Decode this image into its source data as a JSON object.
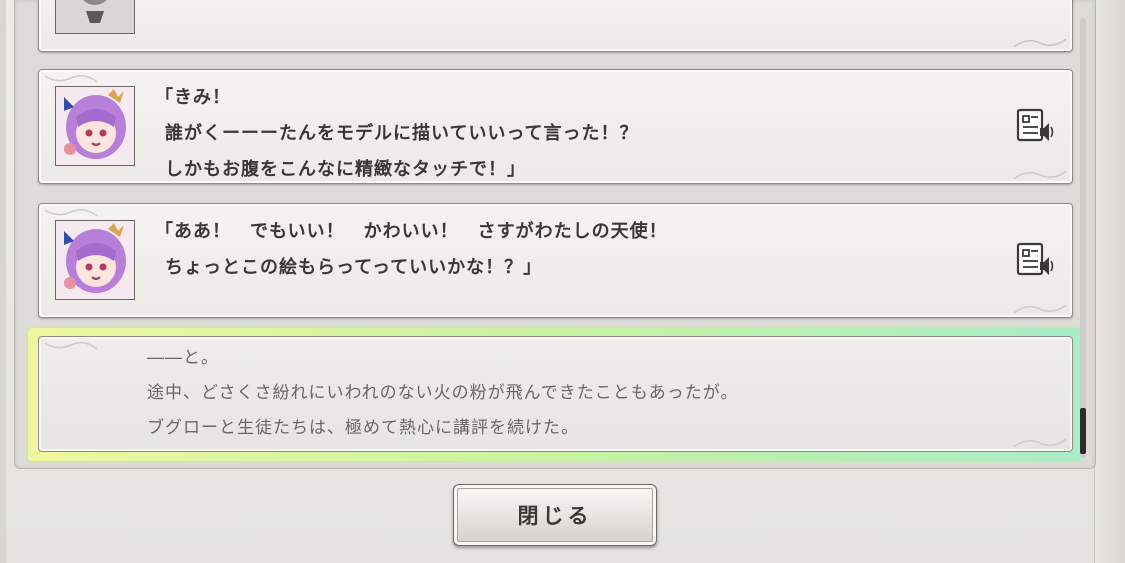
{
  "entries": [
    {
      "speaker": "character",
      "lines": [
        "「きみ！",
        "誰がくーーーたんをモデルに描いていいって言った！？",
        "しかもお腹をこんなに精緻なタッチで！」"
      ],
      "voice_icon": "voice-playback-icon"
    },
    {
      "speaker": "character",
      "lines": [
        "「ああ！　でもいい！　かわいい！　さすがわたしの天使！",
        "ちょっとこの絵もらってっていいかな！？」"
      ],
      "voice_icon": "voice-playback-icon"
    }
  ],
  "narration": {
    "lines": [
      "――と。",
      "途中、どさくさ紛れにいわれのない火の粉が飛んできたこともあったが。",
      "ブグローと生徒たちは、極めて熱心に講評を続けた。"
    ]
  },
  "close_button": {
    "label": "閉じる"
  },
  "colors": {
    "highlight_glow_start": "#eef7a0",
    "highlight_glow_end": "#a8ecc8",
    "panel": "#dddcd8"
  }
}
